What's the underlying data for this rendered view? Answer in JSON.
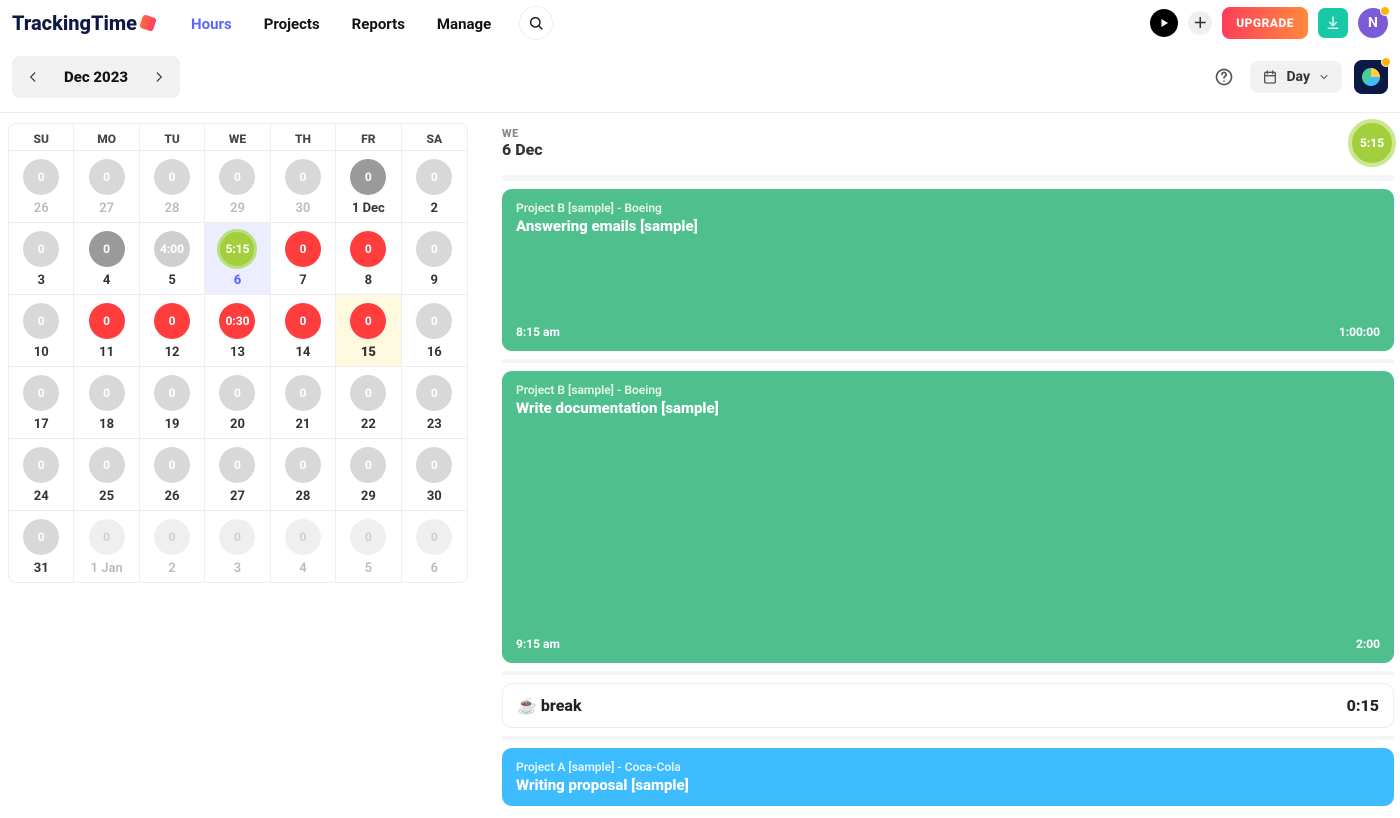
{
  "brand": "TrackingTime",
  "nav": {
    "hours": "Hours",
    "projects": "Projects",
    "reports": "Reports",
    "manage": "Manage"
  },
  "upgrade_label": "UPGRADE",
  "avatar_initial": "N",
  "date_nav": {
    "label": "Dec 2023"
  },
  "view_selector": {
    "label": "Day"
  },
  "calendar": {
    "headers": [
      "SU",
      "MO",
      "TU",
      "WE",
      "TH",
      "FR",
      "SA"
    ],
    "rows": [
      [
        {
          "val": "0",
          "date": "26",
          "circ": "c-gray",
          "cell": "muted"
        },
        {
          "val": "0",
          "date": "27",
          "circ": "c-gray",
          "cell": "muted"
        },
        {
          "val": "0",
          "date": "28",
          "circ": "c-gray",
          "cell": "muted"
        },
        {
          "val": "0",
          "date": "29",
          "circ": "c-gray",
          "cell": "muted"
        },
        {
          "val": "0",
          "date": "30",
          "circ": "c-gray",
          "cell": "muted"
        },
        {
          "val": "0",
          "date": "1 Dec",
          "circ": "c-dark",
          "cell": ""
        },
        {
          "val": "0",
          "date": "2",
          "circ": "c-gray",
          "cell": ""
        }
      ],
      [
        {
          "val": "0",
          "date": "3",
          "circ": "c-gray",
          "cell": ""
        },
        {
          "val": "0",
          "date": "4",
          "circ": "c-dark",
          "cell": ""
        },
        {
          "val": "4:00",
          "date": "5",
          "circ": "c-grayfill",
          "cell": ""
        },
        {
          "val": "5:15",
          "date": "6",
          "circ": "c-green",
          "cell": "selected"
        },
        {
          "val": "0",
          "date": "7",
          "circ": "c-red",
          "cell": ""
        },
        {
          "val": "0",
          "date": "8",
          "circ": "c-red",
          "cell": ""
        },
        {
          "val": "0",
          "date": "9",
          "circ": "c-gray",
          "cell": ""
        }
      ],
      [
        {
          "val": "0",
          "date": "10",
          "circ": "c-gray",
          "cell": ""
        },
        {
          "val": "0",
          "date": "11",
          "circ": "c-red",
          "cell": ""
        },
        {
          "val": "0",
          "date": "12",
          "circ": "c-red",
          "cell": ""
        },
        {
          "val": "0:30",
          "date": "13",
          "circ": "c-red",
          "cell": ""
        },
        {
          "val": "0",
          "date": "14",
          "circ": "c-red",
          "cell": ""
        },
        {
          "val": "0",
          "date": "15",
          "circ": "c-red",
          "cell": "today"
        },
        {
          "val": "0",
          "date": "16",
          "circ": "c-gray",
          "cell": ""
        }
      ],
      [
        {
          "val": "0",
          "date": "17",
          "circ": "c-gray",
          "cell": ""
        },
        {
          "val": "0",
          "date": "18",
          "circ": "c-gray",
          "cell": ""
        },
        {
          "val": "0",
          "date": "19",
          "circ": "c-gray",
          "cell": ""
        },
        {
          "val": "0",
          "date": "20",
          "circ": "c-gray",
          "cell": ""
        },
        {
          "val": "0",
          "date": "21",
          "circ": "c-gray",
          "cell": ""
        },
        {
          "val": "0",
          "date": "22",
          "circ": "c-gray",
          "cell": ""
        },
        {
          "val": "0",
          "date": "23",
          "circ": "c-gray",
          "cell": ""
        }
      ],
      [
        {
          "val": "0",
          "date": "24",
          "circ": "c-gray",
          "cell": ""
        },
        {
          "val": "0",
          "date": "25",
          "circ": "c-gray",
          "cell": ""
        },
        {
          "val": "0",
          "date": "26",
          "circ": "c-gray",
          "cell": ""
        },
        {
          "val": "0",
          "date": "27",
          "circ": "c-gray",
          "cell": ""
        },
        {
          "val": "0",
          "date": "28",
          "circ": "c-gray",
          "cell": ""
        },
        {
          "val": "0",
          "date": "29",
          "circ": "c-gray",
          "cell": ""
        },
        {
          "val": "0",
          "date": "30",
          "circ": "c-gray",
          "cell": ""
        }
      ],
      [
        {
          "val": "0",
          "date": "31",
          "circ": "c-gray",
          "cell": ""
        },
        {
          "val": "0",
          "date": "1 Jan",
          "circ": "c-muted",
          "cell": "muted"
        },
        {
          "val": "0",
          "date": "2",
          "circ": "c-muted",
          "cell": "muted"
        },
        {
          "val": "0",
          "date": "3",
          "circ": "c-muted",
          "cell": "muted"
        },
        {
          "val": "0",
          "date": "4",
          "circ": "c-muted",
          "cell": "muted"
        },
        {
          "val": "0",
          "date": "5",
          "circ": "c-muted",
          "cell": "muted"
        },
        {
          "val": "0",
          "date": "6",
          "circ": "c-muted",
          "cell": "muted"
        }
      ]
    ]
  },
  "day": {
    "dow": "WE",
    "date": "6 Dec",
    "total": "5:15"
  },
  "tasks": [
    {
      "kind": "green",
      "size": "h1",
      "project": "Project B [sample] - Boeing",
      "title": "Answering emails [sample]",
      "start": "8:15 am",
      "dur": "1:00:00"
    },
    {
      "kind": "green",
      "size": "h2",
      "project": "Project B [sample] - Boeing",
      "title": "Write documentation [sample]",
      "start": "9:15 am",
      "dur": "2:00"
    },
    {
      "kind": "white",
      "title": "☕ break",
      "dur": "0:15"
    },
    {
      "kind": "blue",
      "size": "",
      "project": "Project A [sample] - Coca-Cola",
      "title": "Writing proposal [sample]"
    }
  ]
}
